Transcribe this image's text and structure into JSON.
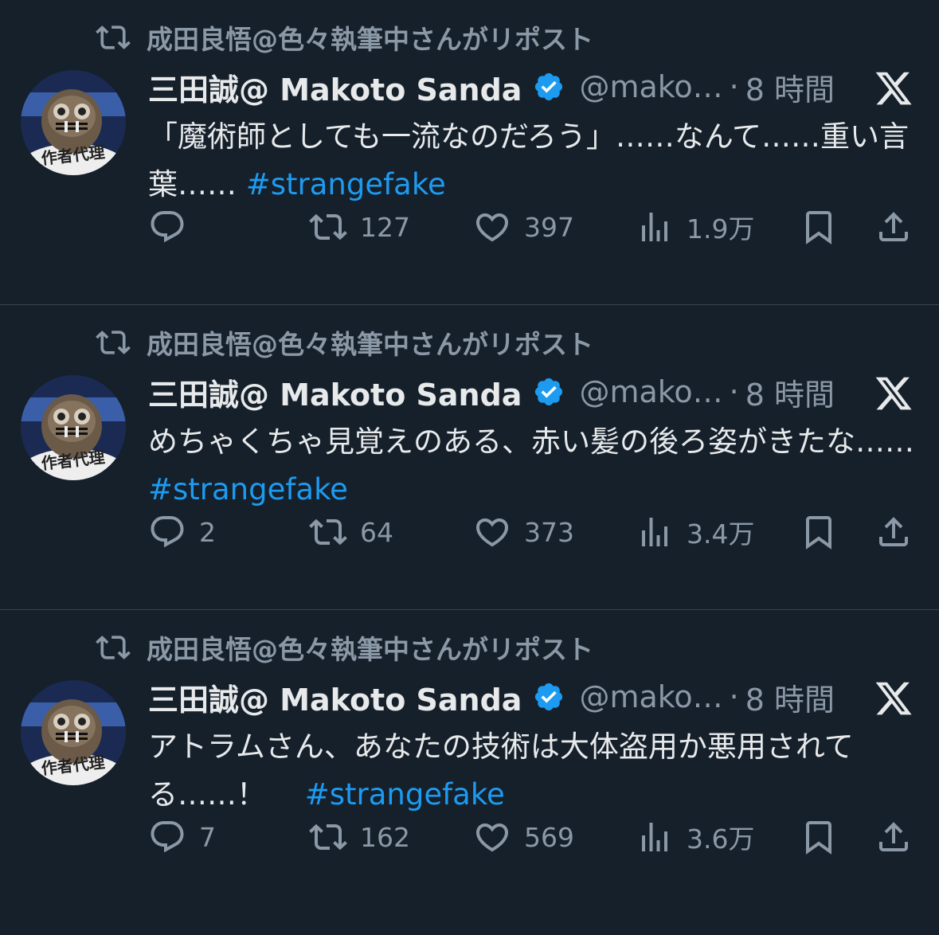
{
  "colors": {
    "background": "#15202b",
    "text": "#e7e9ea",
    "muted": "#8b98a5",
    "link": "#1d9bf0",
    "verified": "#1d9bf0",
    "divider": "#38444d"
  },
  "tweets": [
    {
      "repost_label": "成田良悟@色々執筆中さんがリポスト",
      "avatar_text": "作者代理",
      "name": "三田誠@ Makoto Sanda",
      "handle": "@mako…",
      "dot": "·",
      "time": "8 時間",
      "text": "「魔術師としても一流なのだろう」……なんて……重い言葉……",
      "hashtag": "#strangefake",
      "replies": "",
      "reposts": "127",
      "likes": "397",
      "views": "1.9万"
    },
    {
      "repost_label": "成田良悟@色々執筆中さんがリポスト",
      "avatar_text": "作者代理",
      "name": "三田誠@ Makoto Sanda",
      "handle": "@mako…",
      "dot": "·",
      "time": "8 時間",
      "text": "めちゃくちゃ見覚えのある、赤い髪の後ろ姿がきたな……",
      "hashtag": "#strangefake",
      "replies": "2",
      "reposts": "64",
      "likes": "373",
      "views": "3.4万"
    },
    {
      "repost_label": "成田良悟@色々執筆中さんがリポスト",
      "avatar_text": "作者代理",
      "name": "三田誠@ Makoto Sanda",
      "handle": "@mako…",
      "dot": "·",
      "time": "8 時間",
      "text": "アトラムさん、あなたの技術は大体盗用か悪用されてる……！　",
      "hashtag": "#strangefake",
      "replies": "7",
      "reposts": "162",
      "likes": "569",
      "views": "3.6万"
    }
  ],
  "icons": {
    "repost_header": "repost-icon",
    "verified": "verified-badge-icon",
    "platform": "x-logo-icon",
    "reply": "reply-icon",
    "repost": "repost-icon",
    "like": "heart-icon",
    "views": "views-chart-icon",
    "bookmark": "bookmark-icon",
    "share": "share-icon"
  }
}
